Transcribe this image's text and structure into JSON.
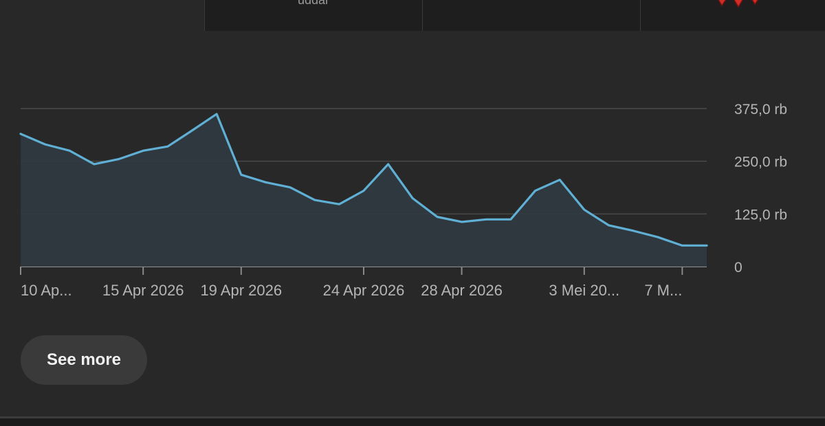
{
  "top_tabs": [
    {
      "label": "uddar"
    },
    {
      "label": ""
    },
    {
      "label": ""
    }
  ],
  "colors": {
    "background": "#282828",
    "line": "#5fb0d4",
    "area": "#2f3a40",
    "grid": "#4a4a4a",
    "axis_text": "#b5b5b5",
    "logo_red": "#d22c26"
  },
  "icons": {
    "thumbnail_logo": "red-logo-icon"
  },
  "chart_data": {
    "type": "area",
    "title": "",
    "xlabel": "",
    "ylabel": "",
    "ylim": [
      0,
      375000
    ],
    "y_ticks": [
      {
        "value": 0,
        "label": "0"
      },
      {
        "value": 125000,
        "label": "125,0 rb"
      },
      {
        "value": 250000,
        "label": "250,0 rb"
      },
      {
        "value": 375000,
        "label": "375,0 rb"
      }
    ],
    "x": [
      "2026-04-10",
      "2026-04-11",
      "2026-04-12",
      "2026-04-13",
      "2026-04-14",
      "2026-04-15",
      "2026-04-16",
      "2026-04-17",
      "2026-04-18",
      "2026-04-19",
      "2026-04-20",
      "2026-04-21",
      "2026-04-22",
      "2026-04-23",
      "2026-04-24",
      "2026-04-25",
      "2026-04-26",
      "2026-04-27",
      "2026-04-28",
      "2026-04-29",
      "2026-04-30",
      "2026-05-01",
      "2026-05-02",
      "2026-05-03",
      "2026-05-04",
      "2026-05-05",
      "2026-05-06",
      "2026-05-07",
      "2026-05-08"
    ],
    "series": [
      {
        "values": [
          315000,
          290000,
          275000,
          243000,
          255000,
          275000,
          285000,
          323000,
          362000,
          218000,
          200000,
          188000,
          158000,
          148000,
          180000,
          243000,
          162000,
          118000,
          106000,
          112000,
          112000,
          180000,
          206000,
          135000,
          98000,
          85000,
          70000,
          50000,
          50000
        ]
      }
    ],
    "x_tick_labels": [
      {
        "date": "2026-04-10",
        "label": "10 Ap..."
      },
      {
        "date": "2026-04-15",
        "label": "15 Apr 2026"
      },
      {
        "date": "2026-04-19",
        "label": "19 Apr 2026"
      },
      {
        "date": "2026-04-24",
        "label": "24 Apr 2026"
      },
      {
        "date": "2026-04-28",
        "label": "28 Apr 2026"
      },
      {
        "date": "2026-05-03",
        "label": "3 Mei 20..."
      },
      {
        "date": "2026-05-07",
        "label": "7 M..."
      }
    ],
    "grid": true
  },
  "actions": {
    "see_more_label": "See more"
  }
}
